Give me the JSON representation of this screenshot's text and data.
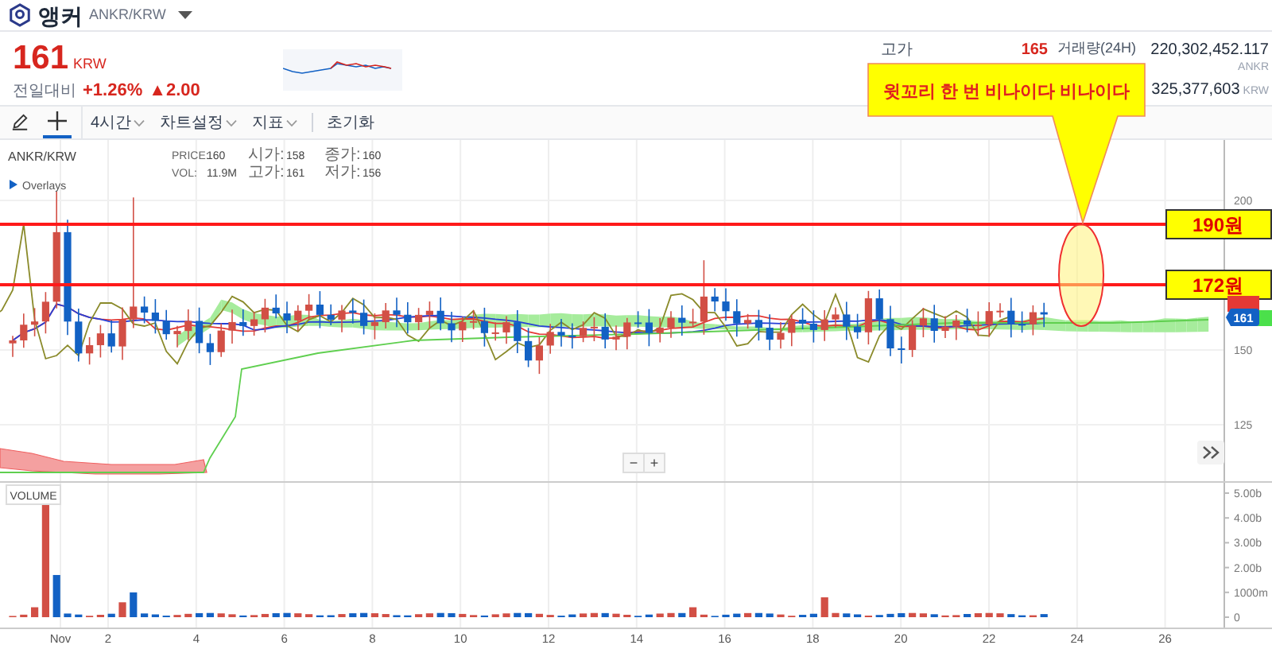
{
  "header": {
    "coin_name": "앵커",
    "pair": "ANKR/KRW"
  },
  "price": {
    "value": "161",
    "currency": "KRW",
    "change_label": "전일대비",
    "change_percent": "+1.26%",
    "change_amount": "▲2.00"
  },
  "stats": [
    {
      "label": "고가",
      "value": "165",
      "highlight": true
    },
    {
      "label": "거래량(24H)",
      "value": "220,302,452.117",
      "unit": "ANKR",
      "highlight": false
    },
    {
      "value": "325,377,603",
      "unit": "KRW",
      "highlight": false
    }
  ],
  "tools": [
    {
      "kind": "pencil",
      "selected": false
    },
    {
      "kind": "crosshair",
      "selected": true
    }
  ],
  "menu": [
    {
      "label": "4시간",
      "dropdown": true
    },
    {
      "label": "차트설정",
      "dropdown": true
    },
    {
      "label": "지표",
      "dropdown": true
    },
    {
      "label": "초기화",
      "dropdown": false
    }
  ],
  "chart": {
    "symbol": "ANKR/KRW",
    "overlays_label": "Overlays",
    "legend": [
      {
        "label": "PRICE:",
        "value": "160"
      },
      {
        "label": "시가:",
        "value": "158"
      },
      {
        "label": "종가:",
        "value": "160"
      },
      {
        "label": "VOL:",
        "value": "11.9M"
      },
      {
        "label": "고가:",
        "value": "161"
      },
      {
        "label": "저가:",
        "value": "156"
      }
    ],
    "price_ticks": [
      "200",
      "150",
      "125"
    ],
    "current_price_tag": "161",
    "zoom_buttons": [
      "−",
      "+"
    ],
    "volume_label": "VOLUME",
    "volume_ticks": [
      "5.00b",
      "4.00b",
      "3.00b",
      "2.00b",
      "1000m",
      "0"
    ],
    "x_ticks": [
      "Nov",
      "2",
      "4",
      "6",
      "8",
      "10",
      "12",
      "14",
      "16",
      "18",
      "20",
      "22",
      "24",
      "26"
    ],
    "levels": [
      {
        "label": "190원"
      },
      {
        "label": "172원"
      }
    ],
    "callout": "윗꼬리 한 번 비나이다 비나이다"
  }
}
